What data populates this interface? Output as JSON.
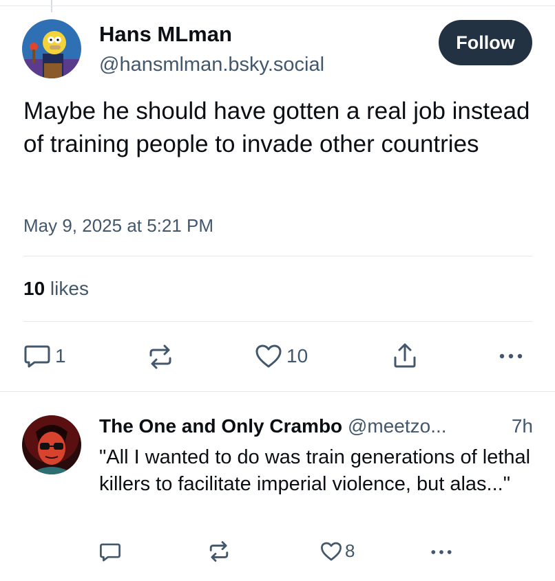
{
  "post": {
    "author_name": "Hans MLman",
    "author_handle": "@hansmlman.bsky.social",
    "follow_label": "Follow",
    "text": "Maybe he should have gotten a real job instead of training people to invade other countries",
    "timestamp": "May 9, 2025 at 5:21 PM",
    "likes_count": "10",
    "likes_label": " likes",
    "actions": {
      "reply_icon": "reply-icon",
      "reply_count": "1",
      "repost_icon": "repost-icon",
      "like_icon": "heart-icon",
      "like_count": "10",
      "share_icon": "share-icon",
      "more_icon": "more-icon"
    }
  },
  "reply": {
    "author_name": "The One and Only Crambo",
    "author_handle": "@meetzo...",
    "time": "7h",
    "text": "\"All I wanted to do was train generations of lethal killers to facilitate imperial violence, but alas...\"",
    "actions": {
      "reply_icon": "reply-icon",
      "repost_icon": "repost-icon",
      "like_icon": "heart-icon",
      "like_count": "8",
      "more_icon": "more-icon"
    }
  },
  "colors": {
    "primary_text": "#0b0f14",
    "secondary_text": "#42576c",
    "follow_button_bg": "#233242",
    "divider": "#e4e8ec"
  }
}
